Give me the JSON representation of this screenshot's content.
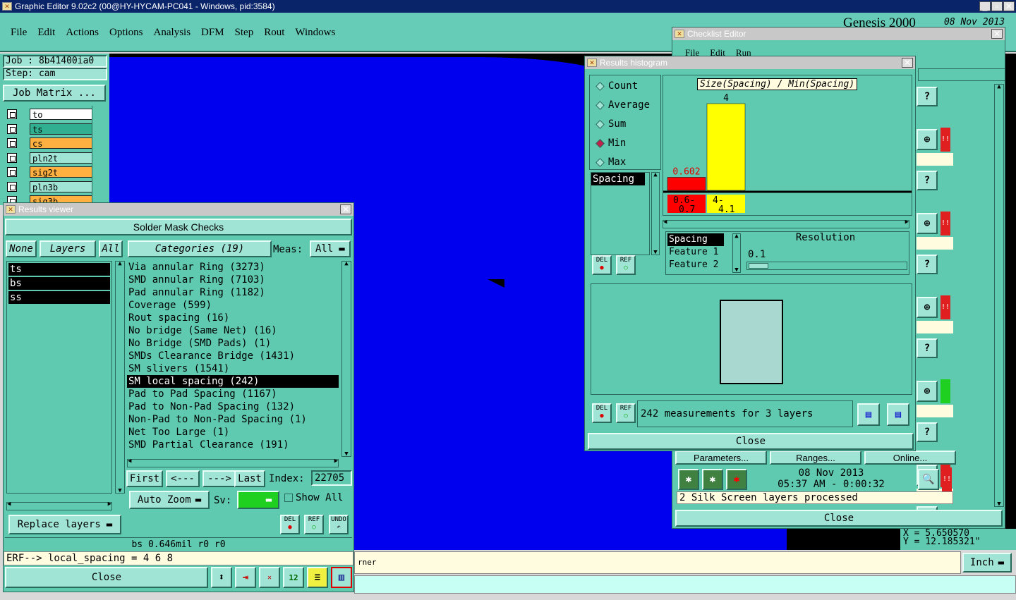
{
  "app": {
    "title": "Graphic Editor 9.02c2 (00@HY-HYCAM-PC041 - Windows, pid:3584)",
    "brand": "Genesis 2000",
    "date": "08 Nov 2013"
  },
  "menu": [
    "File",
    "Edit",
    "Actions",
    "Options",
    "Analysis",
    "DFM",
    "Step",
    "Rout",
    "Windows"
  ],
  "job": {
    "job": "Job : 8b41400ia0",
    "step": "Step: cam",
    "matrix": "Job Matrix ..."
  },
  "layers": [
    {
      "name": "to",
      "color": "#ffffff"
    },
    {
      "name": "ts",
      "color": "#30b090"
    },
    {
      "name": "cs",
      "color": "#ffb040"
    },
    {
      "name": "pln2t",
      "color": "#a0e4d6"
    },
    {
      "name": "sig2t",
      "color": "#ffb040"
    },
    {
      "name": "pln3b",
      "color": "#a0e4d6"
    },
    {
      "name": "sig3b",
      "color": "#ffb040"
    }
  ],
  "results": {
    "title": "Results viewer",
    "header": "Solder Mask Checks",
    "none": "None",
    "layers": "Layers",
    "all": "All",
    "categories": "Categories (19)",
    "meas_label": "Meas:",
    "meas_value": "All",
    "layer_list": [
      "ts",
      "bs",
      "ss"
    ],
    "items": [
      "Via annular Ring (3273)",
      "SMD annular Ring (7103)",
      "Pad annular Ring (1182)",
      "Coverage (599)",
      "Rout spacing (16)",
      "No bridge (Same Net) (16)",
      "No Bridge (SMD Pads) (1)",
      "SMDs Clearance Bridge (1431)",
      "SM slivers (1541)",
      "SM local spacing (242)",
      "Pad to Pad Spacing (1167)",
      "Pad to Non-Pad Spacing (132)",
      "Non-Pad to Non-Pad Spacing (1)",
      "Net Too Large (1)",
      "SMD Partial Clearance (191)"
    ],
    "selected_index": 9,
    "first": "First",
    "prev": "<---",
    "next": "--->",
    "last": "Last",
    "index_label": "Index:",
    "index_value": "22705",
    "auto_zoom": "Auto Zoom",
    "sv": "Sv:",
    "show_all": "Show All",
    "replace": "Replace layers",
    "status": "bs 0.646mil  r0  r0",
    "erf": "ERF--> local_spacing = 4 6 8",
    "close": "Close",
    "del": "DEL",
    "ref": "REF",
    "undo": "UNDO"
  },
  "histogram": {
    "title": "Results histogram",
    "radios": [
      "Count",
      "Average",
      "Sum",
      "Min",
      "Max"
    ],
    "selected": "Min",
    "chart_title": "Size(Spacing) / Min(Spacing)",
    "spacing": "Spacing",
    "options": [
      "Spacing",
      "Feature 1",
      "Feature 2"
    ],
    "resolution_label": "Resolution",
    "resolution": "0.1",
    "summary": "242 measurements for 3 layers",
    "close": "Close",
    "del": "DEL",
    "ref": "REF"
  },
  "chart_data": {
    "type": "bar",
    "categories": [
      "0.6- 0.7",
      "4- 4.1"
    ],
    "values": [
      0.602,
      4
    ],
    "labels": [
      "0.602",
      "4"
    ],
    "colors": [
      "#ff0000",
      "#ffff00"
    ],
    "title": "Size(Spacing) / Min(Spacing)"
  },
  "checklist": {
    "title": "Checklist Editor",
    "menu": [
      "File",
      "Edit",
      "Run"
    ],
    "q": "?",
    "params": "Parameters...",
    "ranges": "Ranges...",
    "online": "Online...",
    "date": "08 Nov 2013",
    "time": "05:37 AM - 0:00:32",
    "status": "2 Silk Screen layers processed",
    "close": "Close"
  },
  "coords": {
    "x": "X = 5.650570",
    "y": "Y = 12.185321\""
  },
  "bottom": {
    "message": "rner",
    "unit": "Inch"
  }
}
